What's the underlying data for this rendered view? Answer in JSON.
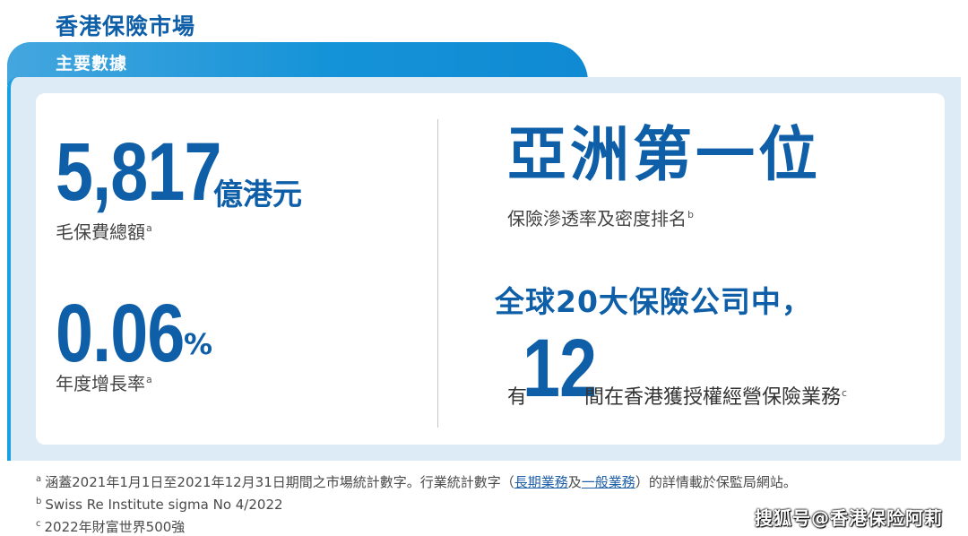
{
  "header": {
    "title": "香港保險市場",
    "tab_label": "主要數據"
  },
  "stats": {
    "premium": {
      "value": "5,817",
      "unit": "億港元",
      "label": "毛保費總額",
      "note": "a"
    },
    "growth": {
      "value": "0.06",
      "unit": "%",
      "label": "年度增長率",
      "note": "a"
    },
    "rank": {
      "headline": "亞洲第一位",
      "label": "保險滲透率及密度排名",
      "note": "b"
    },
    "global": {
      "headline": "全球20大保險公司中，",
      "prefix": "有",
      "count": "12",
      "suffix": "間在香港獲授權經營保險業務",
      "note": "c"
    }
  },
  "footnotes": {
    "a": {
      "mark": "a",
      "text_before": "涵蓋2021年1月1日至2021年12月31日期間之市場統計數字。行業統計數字（",
      "link1": "長期業務",
      "mid": "及",
      "link2": "一般業務",
      "text_after": "）的詳情載於保監局網站。"
    },
    "b": {
      "mark": "b",
      "text": "Swiss Re Institute sigma No 4/2022"
    },
    "c": {
      "mark": "c",
      "text": "2022年財富世界500強"
    }
  },
  "watermark": "搜狐号@香港保险阿莉",
  "colors": {
    "brand_blue": "#0e5fa8",
    "tab_blue": "#1593d8",
    "panel_bg": "#dcebf6"
  }
}
